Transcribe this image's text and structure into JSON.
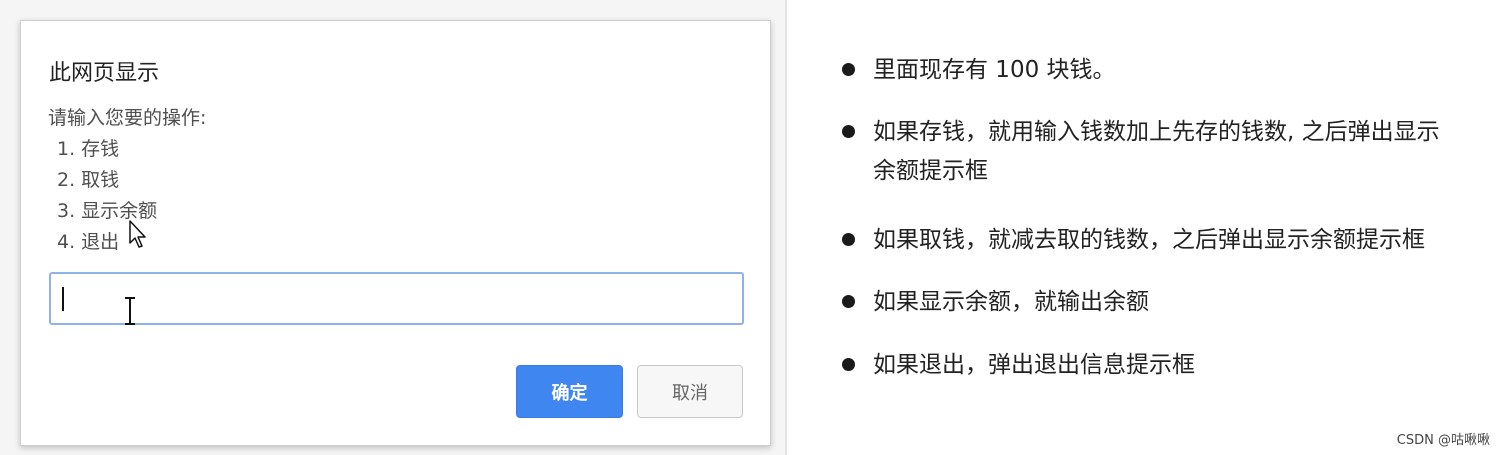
{
  "dialog": {
    "title": "此网页显示",
    "message": {
      "prompt": "请输入您要的操作:",
      "options": [
        "1. 存钱",
        "2. 取钱",
        "3. 显示余额",
        "4. 退出"
      ]
    },
    "input_value": "",
    "ok_label": "确定",
    "cancel_label": "取消",
    "ok_color": "#3f86f0"
  },
  "cursors": [
    "text-cursor-icon",
    "arrow-cursor-icon"
  ],
  "notes": [
    {
      "lines": [
        "里面现存有 100 块钱。"
      ]
    },
    {
      "lines": [
        "如果存钱，就用输入钱数加上先存的钱数, 之后弹出显示",
        "余额提示框"
      ]
    },
    {
      "lines": [
        "如果取钱，就减去取的钱数，之后弹出显示余额提示框"
      ]
    },
    {
      "lines": [
        "如果显示余额，就输出余额"
      ]
    },
    {
      "lines": [
        "如果退出，弹出退出信息提示框"
      ]
    }
  ],
  "watermark": "CSDN @咕啾啾"
}
